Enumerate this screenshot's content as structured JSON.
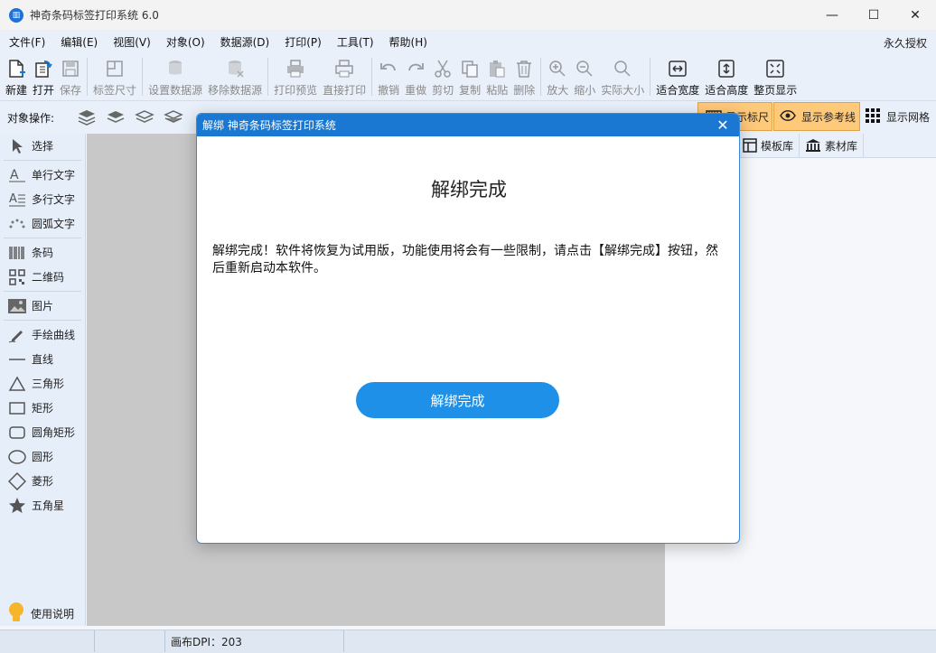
{
  "window": {
    "title": "神奇条码标签打印系统 6.0",
    "icon": "app-logo-icon"
  },
  "menu": {
    "items": [
      "文件(F)",
      "编辑(E)",
      "视图(V)",
      "对象(O)",
      "数据源(D)",
      "打印(P)",
      "工具(T)",
      "帮助(H)"
    ],
    "license": "永久授权"
  },
  "toolbar": {
    "new": "新建",
    "open": "打开",
    "save": "保存",
    "label_size": "标签尺寸",
    "set_datasource": "设置数据源",
    "remove_datasource": "移除数据源",
    "print_preview": "打印预览",
    "direct_print": "直接打印",
    "undo": "撤销",
    "redo": "重做",
    "cut": "剪切",
    "copy": "复制",
    "paste": "粘贴",
    "delete": "删除",
    "zoom_in": "放大",
    "zoom_out": "缩小",
    "actual_size": "实际大小",
    "fit_width": "适合宽度",
    "fit_height": "适合高度",
    "full_page": "整页显示"
  },
  "objbar": {
    "label": "对象操作:",
    "show_ruler": "显示标尺",
    "show_guides": "显示参考线",
    "show_grid": "显示网格"
  },
  "leftpanel": {
    "select": "选择",
    "single_text": "单行文字",
    "multi_text": "多行文字",
    "arc_text": "圆弧文字",
    "barcode": "条码",
    "qrcode": "二维码",
    "image": "图片",
    "freehand": "手绘曲线",
    "line": "直线",
    "triangle": "三角形",
    "rectangle": "矩形",
    "rounded_rect": "圆角矩形",
    "circle": "圆形",
    "diamond": "菱形",
    "star": "五角星",
    "help": "使用说明"
  },
  "rightpanel": {
    "tab_templates": "模板库",
    "tab_assets": "素材库"
  },
  "statusbar": {
    "dpi": "画布DPI：203"
  },
  "dialog": {
    "title": "解绑 神奇条码标签打印系统",
    "heading": "解绑完成",
    "message": "解绑完成！软件将恢复为试用版，功能使用将会有一些限制，请点击【解绑完成】按钮，然后重新启动本软件。",
    "button": "解绑完成"
  },
  "colors": {
    "accent": "#1a78d2",
    "button": "#1e90e8",
    "toggle_on": "#ffc97a"
  }
}
